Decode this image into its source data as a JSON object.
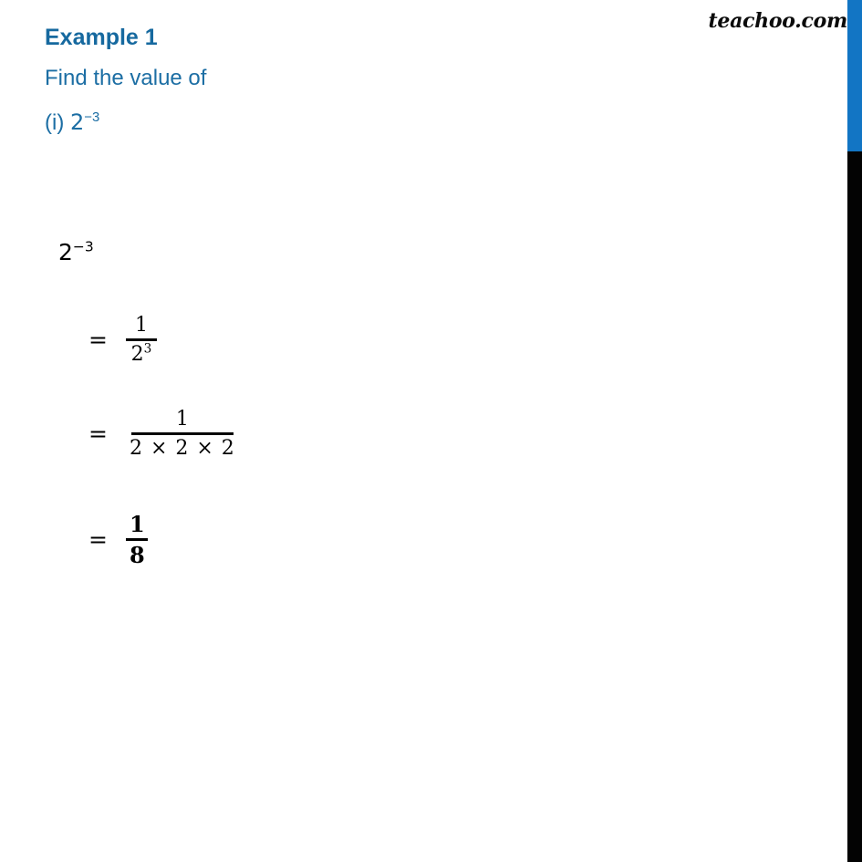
{
  "page": {
    "background_color": "#ffffff",
    "accent_blue": "#16699f",
    "bar_blue": "#1275c4",
    "bar_black": "#030303"
  },
  "watermark": {
    "text": "teachoo.com"
  },
  "heading": {
    "example_label": "Example 1",
    "instruction": "Find the value of",
    "part_label": "(i) ",
    "part_base": "2",
    "part_exponent": "−3"
  },
  "solution": {
    "start_expression": {
      "base": "2",
      "exponent": "−3"
    },
    "steps": [
      {
        "equals": "=",
        "numerator": "1",
        "denominator_base": "2",
        "denominator_exponent": "3",
        "bold": false
      },
      {
        "equals": "=",
        "numerator": "1",
        "denominator": "2 × 2 × 2",
        "bold": false
      },
      {
        "equals": "=",
        "numerator": "1",
        "denominator": "8",
        "bold": true
      }
    ]
  }
}
